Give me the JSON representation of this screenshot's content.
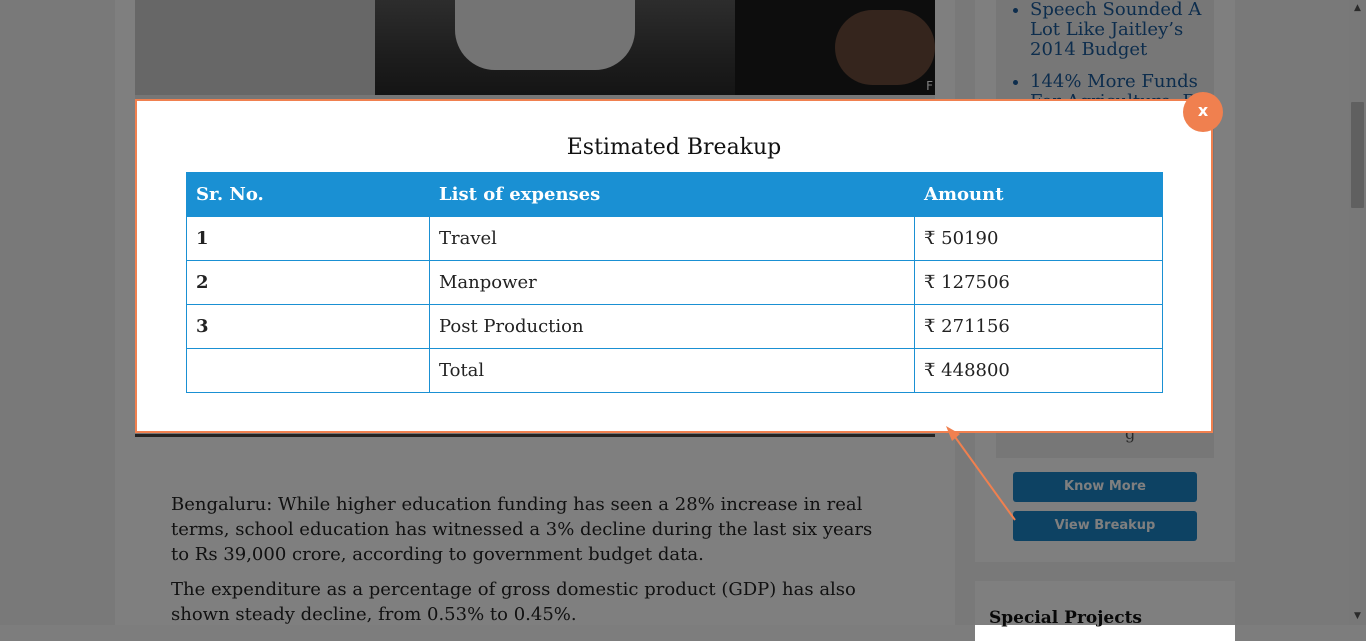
{
  "hero": {
    "credit": "F"
  },
  "article": {
    "paragraphs": [
      "Bengaluru: While higher education funding has seen a 28% increase in real terms, school education has witnessed a 3% decline during the last six years to Rs 39,000 crore, according to government budget data.",
      "The expenditure as a percentage of gross domestic product (GDP) has also shown steady decline, from 0.53% to 0.45%."
    ]
  },
  "sidebar": {
    "links": [
      "Speech Sounded A Lot Like Jaitley’s 2014 Budget",
      "144% More Funds For Agriculture, B"
    ],
    "truncated_text": "g",
    "know_more_label": "Know More",
    "view_breakup_label": "View Breakup",
    "special_projects_title": "Special Projects"
  },
  "modal": {
    "title": "Estimated Breakup",
    "close_label": "x",
    "table": {
      "headers": [
        "Sr. No.",
        "List of expenses",
        "Amount"
      ],
      "rows": [
        {
          "sr": "1",
          "item": "Travel",
          "amount": "₹ 50190"
        },
        {
          "sr": "2",
          "item": "Manpower",
          "amount": "₹ 127506"
        },
        {
          "sr": "3",
          "item": "Post Production",
          "amount": "₹ 271156"
        },
        {
          "sr": "",
          "item": "Total",
          "amount": "₹ 448800"
        }
      ]
    }
  },
  "scrollbar": {
    "up_glyph": "▲",
    "down_glyph": "▼"
  },
  "colors": {
    "accent_orange": "#f0804f",
    "table_blue": "#1a90d3",
    "button_blue": "#1a84c7",
    "link_blue": "#1a5a9a"
  }
}
